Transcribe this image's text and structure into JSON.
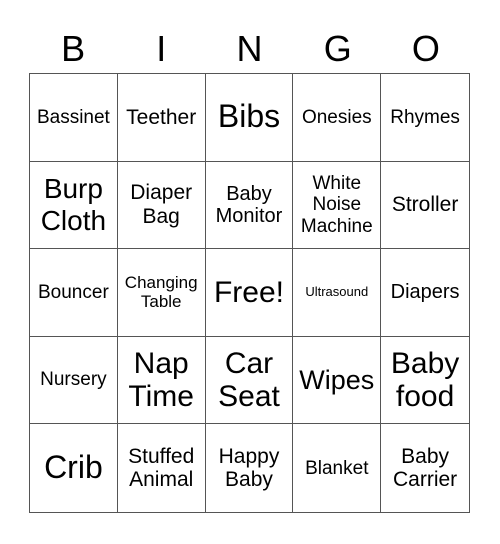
{
  "header": {
    "letters": [
      "B",
      "I",
      "N",
      "G",
      "O"
    ]
  },
  "cells": [
    "Bassinet",
    "Teether",
    "Bibs",
    "Onesies",
    "Rhymes",
    "Burp Cloth",
    "Diaper Bag",
    "Baby Monitor",
    "White Noise Machine",
    "Stroller",
    "Bouncer",
    "Changing Table",
    "Free!",
    "Ultrasound",
    "Diapers",
    "Nursery",
    "Nap Time",
    "Car Seat",
    "Wipes",
    "Baby food",
    "Crib",
    "Stuffed Animal",
    "Happy Baby",
    "Blanket",
    "Baby Carrier"
  ]
}
